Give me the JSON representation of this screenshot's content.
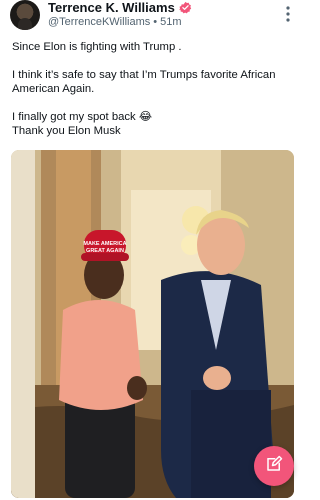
{
  "post": {
    "author": {
      "display_name": "Terrence K. Williams",
      "handle": "@TerrenceKWilliams",
      "separator": "•",
      "time": "51m"
    },
    "text_lines": [
      "Since Elon is fighting with Trump .",
      "I think it’s safe to say that I’m Trumps favorite African American Again.",
      "I finally got my spot back 😂",
      "Thank you Elon Musk"
    ],
    "photo": {
      "hat_text_line1": "MAKE AMERICA",
      "hat_text_line2": "GREAT AGAIN"
    }
  },
  "icons": {
    "verified": "verified-badge-icon",
    "more": "more-vertical-icon",
    "compose": "compose-icon"
  },
  "colors": {
    "verified_badge": "#f2557a",
    "fab": "#f2557a",
    "secondary_text": "#536471"
  }
}
